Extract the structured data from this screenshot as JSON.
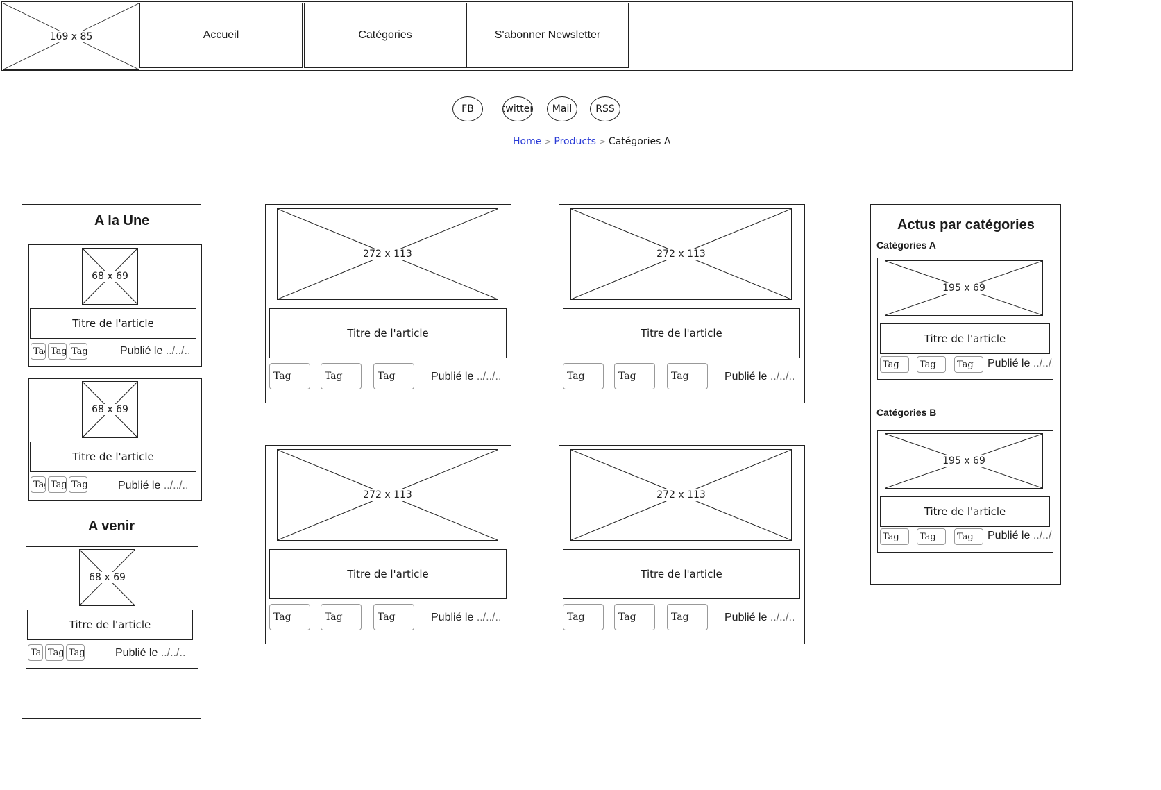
{
  "header": {
    "logo_placeholder": "169 x 85",
    "nav": [
      "Accueil",
      "Catégories",
      "S'abonner Newsletter"
    ]
  },
  "social": [
    "FB",
    "twitter",
    "Mail",
    "RSS"
  ],
  "breadcrumb": {
    "home": "Home",
    "products": "Products",
    "current": "Catégories A",
    "separator": ">"
  },
  "left": {
    "une_title": "A la Une",
    "venir_title": "A venir",
    "thumb_placeholder": "68 x 69",
    "article_title": "Titre de l'article",
    "tag": "Tag",
    "published_label": "Publié le",
    "published_date": "../../.."
  },
  "main": {
    "image_placeholder": "272 x 113",
    "article_title": "Titre de l'article",
    "tag": "Tag",
    "published_label": "Publié le",
    "published_date": "../../.."
  },
  "right": {
    "title": "Actus par catégories",
    "cat_a": "Catégories A",
    "cat_b": "Catégories B",
    "image_placeholder": "195 x 69",
    "article_title": "Titre de l'article",
    "tag": "Tag",
    "published_label": "Publié le",
    "published_date": "../../.."
  }
}
